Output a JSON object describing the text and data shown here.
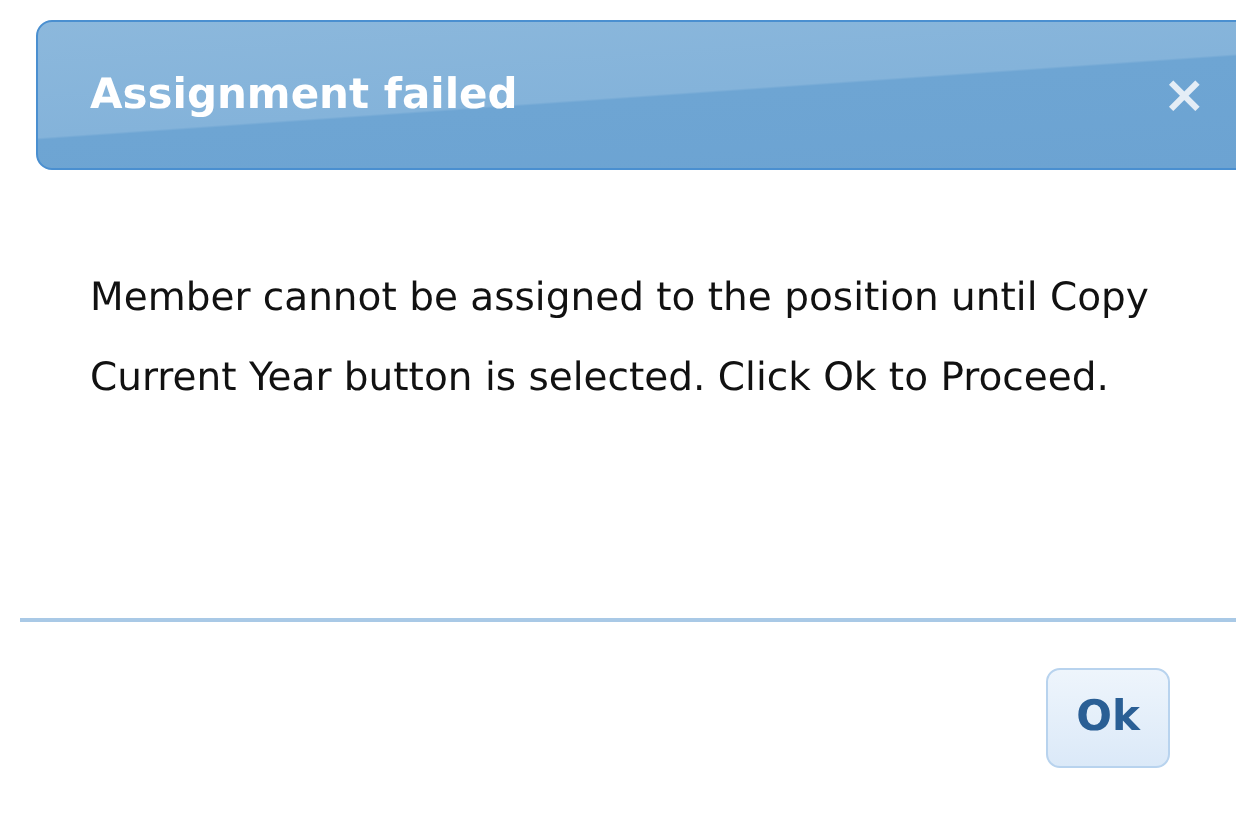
{
  "dialog": {
    "title": "Assignment failed",
    "close": "×",
    "message": "Member cannot be assigned to the position until Copy Current Year button is selected. Click Ok to Proceed.",
    "buttons": [
      {
        "label": "Ok"
      }
    ]
  }
}
